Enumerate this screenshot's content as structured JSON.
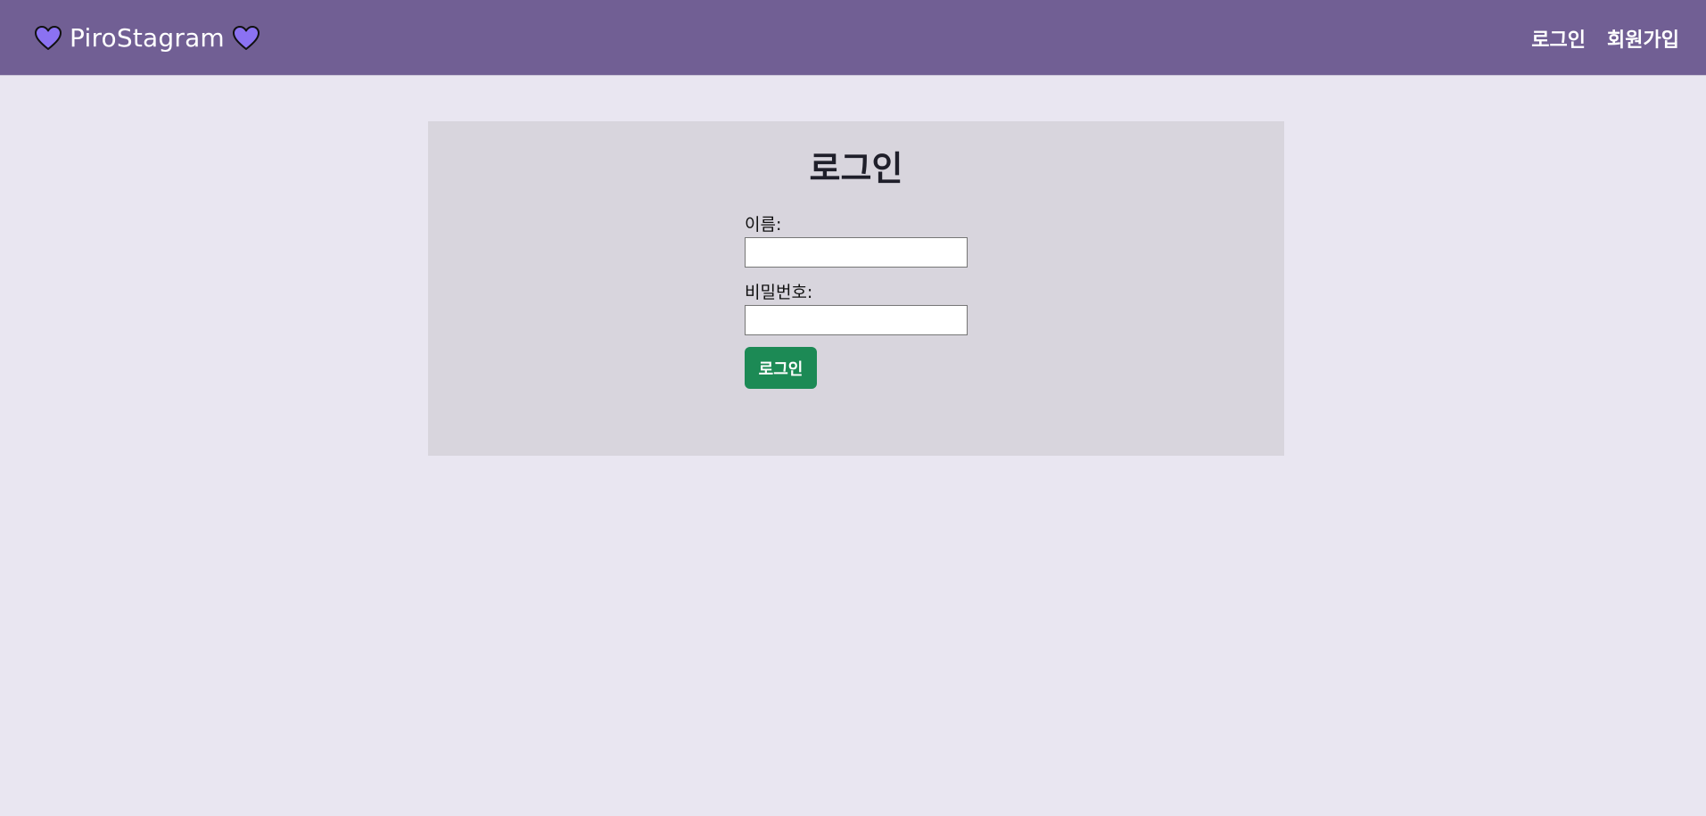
{
  "navbar": {
    "brand_text": "PiroStagram",
    "brand_left_icon": "heart-icon",
    "brand_right_icon": "heart-icon",
    "links": [
      {
        "label": "로그인"
      },
      {
        "label": "회원가입"
      }
    ]
  },
  "login_card": {
    "title": "로그인",
    "fields": [
      {
        "label": "이름:",
        "value": ""
      },
      {
        "label": "비밀번호:",
        "value": ""
      }
    ],
    "submit_label": "로그인"
  },
  "colors": {
    "navbar_bg": "#715f94",
    "page_bg": "#e9e6f1",
    "card_bg": "#d8d5dd",
    "heart_fill": "#8b72f2",
    "submit_bg": "#1c8a55"
  }
}
